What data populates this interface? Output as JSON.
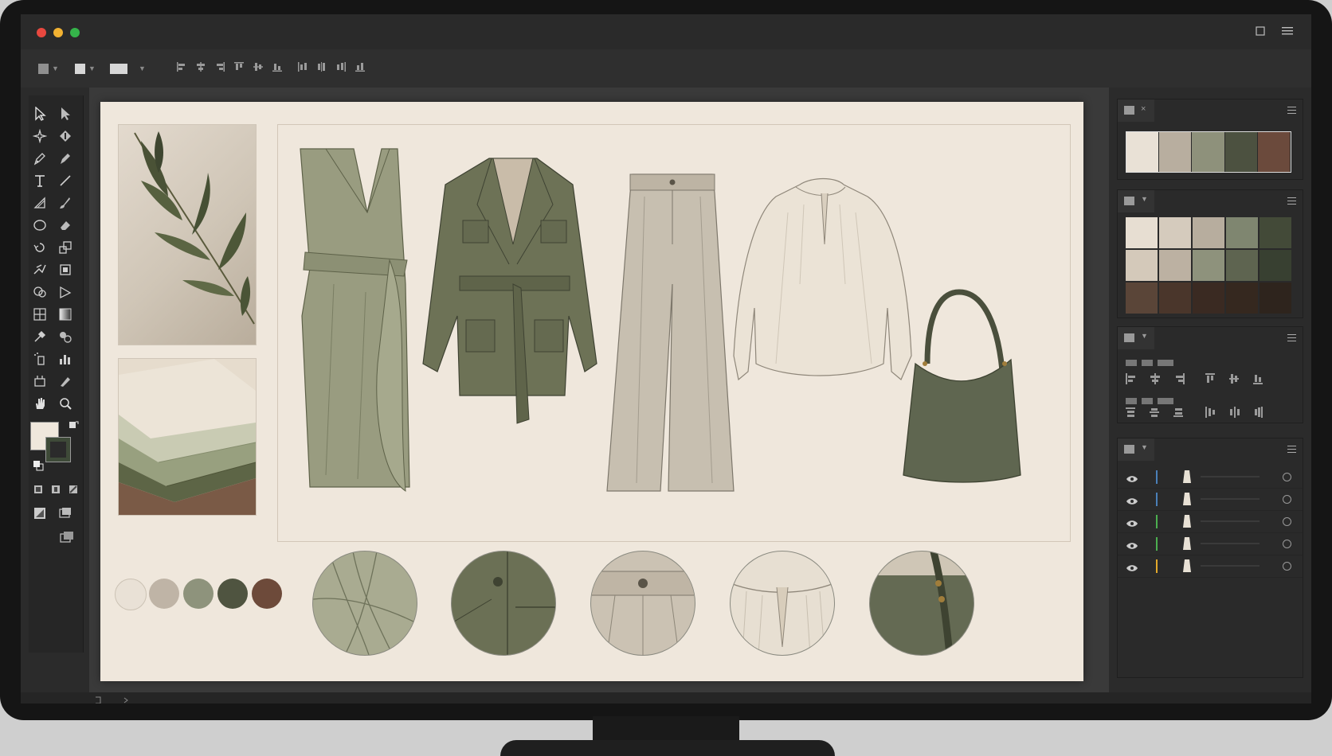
{
  "window": {
    "traffic_lights": [
      "#e8483f",
      "#f2b232",
      "#35b44a"
    ],
    "controls": [
      "maximize-icon",
      "menu-icon"
    ]
  },
  "options_bar": {
    "icons": [
      "fill-swatch-icon",
      "stroke-swatch-icon",
      "opacity-swatch-icon",
      "align-left-icon",
      "align-center-icon",
      "align-right-icon",
      "align-top-icon",
      "align-middle-icon",
      "align-bottom-icon",
      "distribute-left-icon",
      "distribute-center-icon",
      "distribute-right-icon",
      "distribute-bottom-icon"
    ]
  },
  "toolbar": {
    "tools": [
      "selection-tool-icon",
      "direct-selection-tool-icon",
      "magic-wand-icon",
      "lasso-icon",
      "pen-tool-icon",
      "curvature-tool-icon",
      "type-tool-icon",
      "line-tool-icon",
      "rectangle-tool-icon",
      "paintbrush-icon",
      "ellipse-tool-icon",
      "eraser-icon",
      "rotate-tool-icon",
      "scale-tool-icon",
      "warp-tool-icon",
      "free-transform-icon",
      "shape-builder-icon",
      "perspective-grid-icon",
      "mesh-tool-icon",
      "gradient-tool-icon",
      "eyedropper-icon",
      "blend-tool-icon",
      "symbol-sprayer-icon",
      "column-graph-icon",
      "artboard-tool-icon",
      "slice-tool-icon",
      "hand-tool-icon",
      "zoom-tool-icon"
    ],
    "fill_color": "#efe7dc",
    "stroke_color": "#3e4a38"
  },
  "artboard": {
    "background": "#efe7dc",
    "mood_images": [
      "olive-branch-photo",
      "folded-fabric-photo"
    ],
    "garments": [
      "wrap-dress",
      "belted-safari-jacket",
      "wide-leg-trousers",
      "peasant-blouse",
      "hobo-bag"
    ],
    "palette_dots": [
      "#e9e1d6",
      "#bfb4a6",
      "#8e937c",
      "#4f5440",
      "#6d4a3a"
    ],
    "details": [
      "dress-drape-detail",
      "jacket-pocket-detail",
      "trouser-waistband-detail",
      "blouse-neckline-detail",
      "bag-strap-detail"
    ]
  },
  "panels": {
    "swatches_top": [
      "#e9e1d6",
      "#b8ae9f",
      "#8e917b",
      "#4c5140",
      "#6b4a3c"
    ],
    "swatch_grid": [
      [
        "#e7ded2",
        "#d5cbbd",
        "#b7ad9e",
        "#7f8670",
        "#434a38"
      ],
      [
        "#d4c9ba",
        "#bcb1a2",
        "#8e927c",
        "#5e6450",
        "#384031"
      ],
      [
        "#5a4538",
        "#4a362b",
        "#3a2a22",
        "#35281f",
        "#2e241d"
      ]
    ],
    "layers": [
      {
        "thumb": "dress-thumb-icon",
        "color": "#4a7fb8"
      },
      {
        "thumb": "jacket-thumb-icon",
        "color": "#4a7fb8"
      },
      {
        "thumb": "trousers-thumb-icon",
        "color": "#4caf50"
      },
      {
        "thumb": "blouse-thumb-icon",
        "color": "#4caf50"
      },
      {
        "thumb": "bag-thumb-icon",
        "color": "#e3a92b"
      }
    ]
  }
}
